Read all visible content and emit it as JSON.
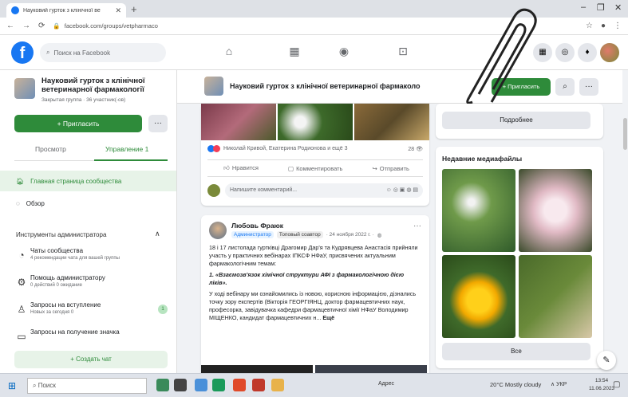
{
  "browser": {
    "tab_title": "Науковий гурток з клінічної ве",
    "url": "facebook.com/groups/vetpharmaco"
  },
  "topbar": {
    "search_placeholder": "Поиск на Facebook"
  },
  "group": {
    "name": "Науковий гурток з клінічної ветеринарної фармакології",
    "meta": "Закрытая группа · 36 участник(-ов)",
    "invite_label": "+ Пригласить",
    "header_name": "Науковий гурток з клінічної ветеринарної фармаколо",
    "header_invite": "+ Пригласить"
  },
  "sidebar": {
    "tab_view": "Просмотр",
    "tab_manage": "Управление 1",
    "home": "Главная страница сообщества",
    "overview": "Обзор",
    "admin_tools_title": "Инструменты администратора",
    "tools": [
      {
        "title": "Чаты сообщества",
        "sub": "4 рекомендации чата для вашей группы"
      },
      {
        "title": "Помощь администратору",
        "sub": "0 действий 0 ожидание"
      },
      {
        "title": "Запросы на вступление",
        "sub": "Новых за сегодня 0",
        "badge": "1"
      },
      {
        "title": "Запросы на получение значка",
        "sub": ""
      }
    ],
    "create_chat": "+ Создать чат"
  },
  "post1": {
    "reactors": "Николай Кривой, Екатерина Родионова и ещё 3",
    "count": "28 👁",
    "like": "Нравится",
    "comment": "Комментировать",
    "share": "Отправить",
    "comment_placeholder": "Напишите комментарий..."
  },
  "post2": {
    "author": "Любовь Фраюк",
    "badge_admin": "Администратор",
    "badge_top": "Топовый соавтор",
    "date": "· 24 ноября 2022 г. · ",
    "p1": "18 і 17 листопада гуртківці Драгомир Дар'я та Кудрявцева Анастасія прийняли участь у практичних вебінарах ІПКСФ НФаУ, присвячених актуальним фармакологічним темам:",
    "p2": "1. «Взаємозв'язок хімічної структури АФІ з фармакологічною дією ліків».",
    "p3": "У ході вебінару ми ознайомились із новою, корисною інформацією, дізнались точку зору експертів (Вікторія ГЕОРГІЯНЦ, доктор фармацевтичних наук, професорка, завідувачка кафедри фармацевтичної хімії НФаУ Володимир МІЩЕНКО, кандидат фармацевтичних н...",
    "more": "Ещё"
  },
  "right": {
    "more_btn": "Подробнее",
    "media_title": "Недавние медиафайлы",
    "all_btn": "Все"
  },
  "taskbar": {
    "search": "Поиск",
    "center_label": "Адрес",
    "weather": "20°C Mostly cloudy",
    "lang": "∧ УКР",
    "time": "13:54",
    "date": "11.06.2023"
  }
}
